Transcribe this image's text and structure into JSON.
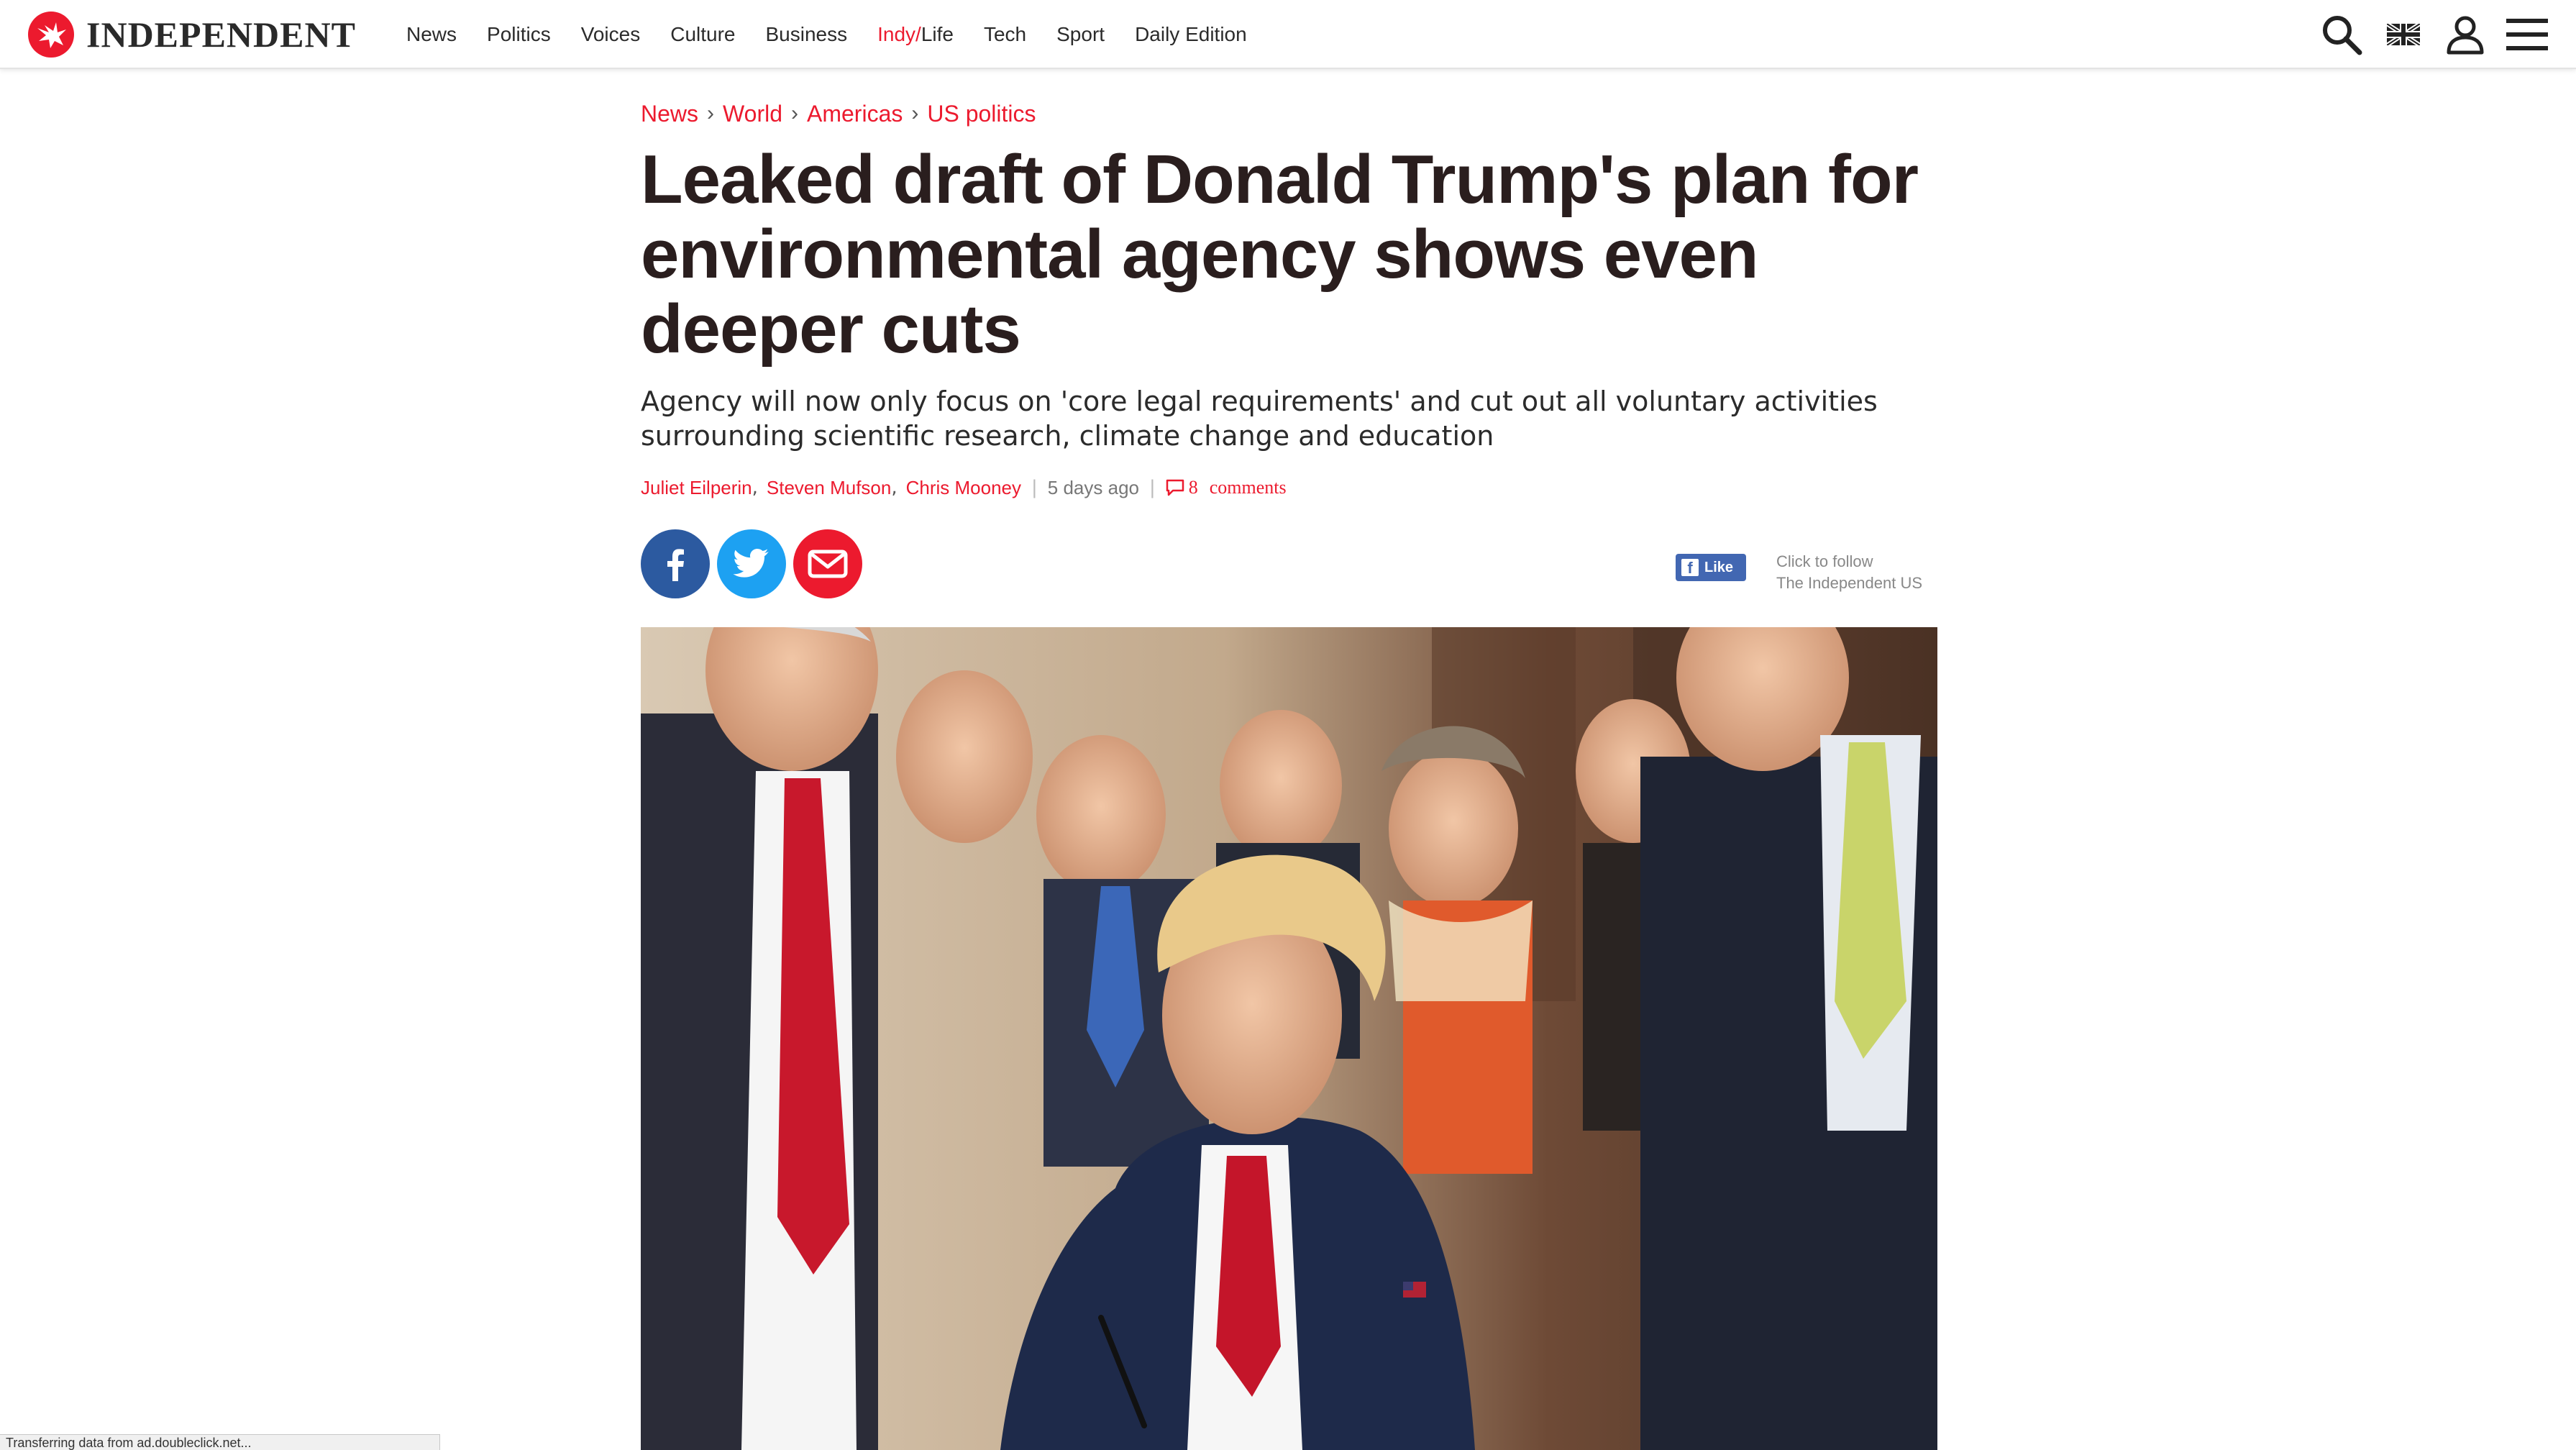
{
  "site": {
    "name": "INDEPENDENT",
    "brand_color": "#ec1a2e"
  },
  "nav": {
    "items": [
      {
        "label": "News"
      },
      {
        "label": "Politics"
      },
      {
        "label": "Voices"
      },
      {
        "label": "Culture"
      },
      {
        "label": "Business"
      },
      {
        "label_red": "Indy/",
        "label_rest": "Life"
      },
      {
        "label": "Tech"
      },
      {
        "label": "Sport"
      },
      {
        "label": "Daily Edition"
      }
    ]
  },
  "tools": {
    "icons": [
      "search-icon",
      "uk-flag-icon",
      "user-icon",
      "menu-icon"
    ]
  },
  "breadcrumb": {
    "items": [
      "News",
      "World",
      "Americas",
      "US politics"
    ],
    "separator": "›"
  },
  "article": {
    "headline": "Leaked draft of Donald Trump's plan for environmental agency shows even deeper cuts",
    "standfirst": "Agency will now only focus on 'core legal requirements' and cut out all voluntary activities surrounding scientific research, climate change and education",
    "authors": [
      "Juliet Eilperin",
      "Steven Mufson",
      "Chris Mooney"
    ],
    "published": "5 days ago",
    "comments_count": "8",
    "comments_label": "comments"
  },
  "social": {
    "like_label": "Like",
    "follow_line1": "Click to follow",
    "follow_line2": "The Independent US",
    "facebook_color": "#2c5aa0",
    "twitter_color": "#1da1f2",
    "email_color": "#ec1a2e"
  },
  "status": {
    "text": "Transferring data from ad.doubleclick.net..."
  }
}
